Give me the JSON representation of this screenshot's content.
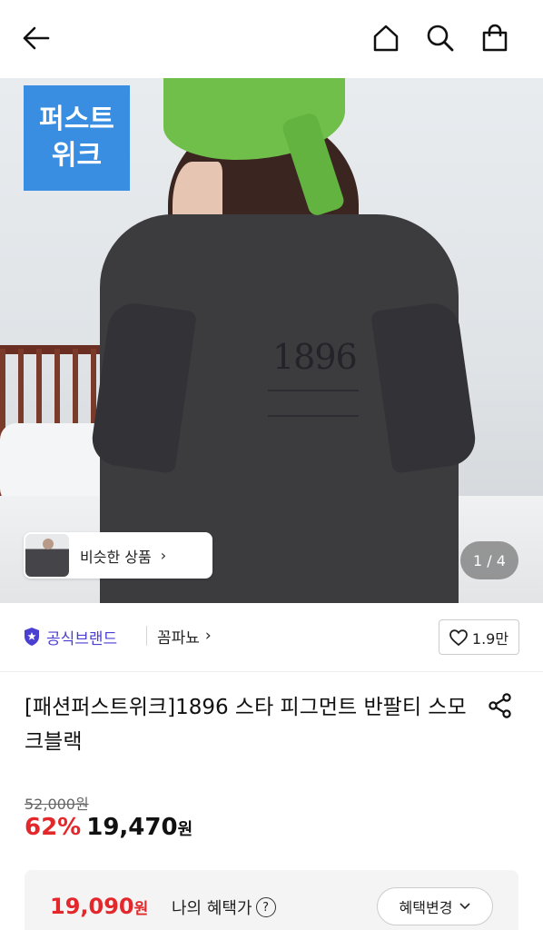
{
  "header": {
    "back_icon": "back-arrow-icon",
    "home_icon": "home-icon",
    "search_icon": "search-icon",
    "bag_icon": "shopping-bag-icon"
  },
  "hero": {
    "brand_tag_line1": "퍼스트",
    "brand_tag_line2": "위크",
    "brand_tag_color": "#3a8ee2",
    "print_text": "1896",
    "similar_label": "비슷한 상품",
    "similar_chevron": "›",
    "pager_text": "1 / 4"
  },
  "brand": {
    "official_label": "공식브랜드",
    "official_color": "#4b3fd1",
    "store_name": "꼼파뇨",
    "store_chevron": "›",
    "likes": "1.9만"
  },
  "product": {
    "title": "[패션퍼스트위크]1896 스타 피그먼트 반팔티 스모크블랙",
    "original_price": "52,000원",
    "discount": "62%",
    "sale_price": "19,470",
    "sale_unit": "원",
    "accent_red": "#e3282c"
  },
  "benefit": {
    "price": "19,090",
    "unit": "원",
    "label": "나의 혜택가",
    "help": "?",
    "change_label": "혜택변경"
  }
}
